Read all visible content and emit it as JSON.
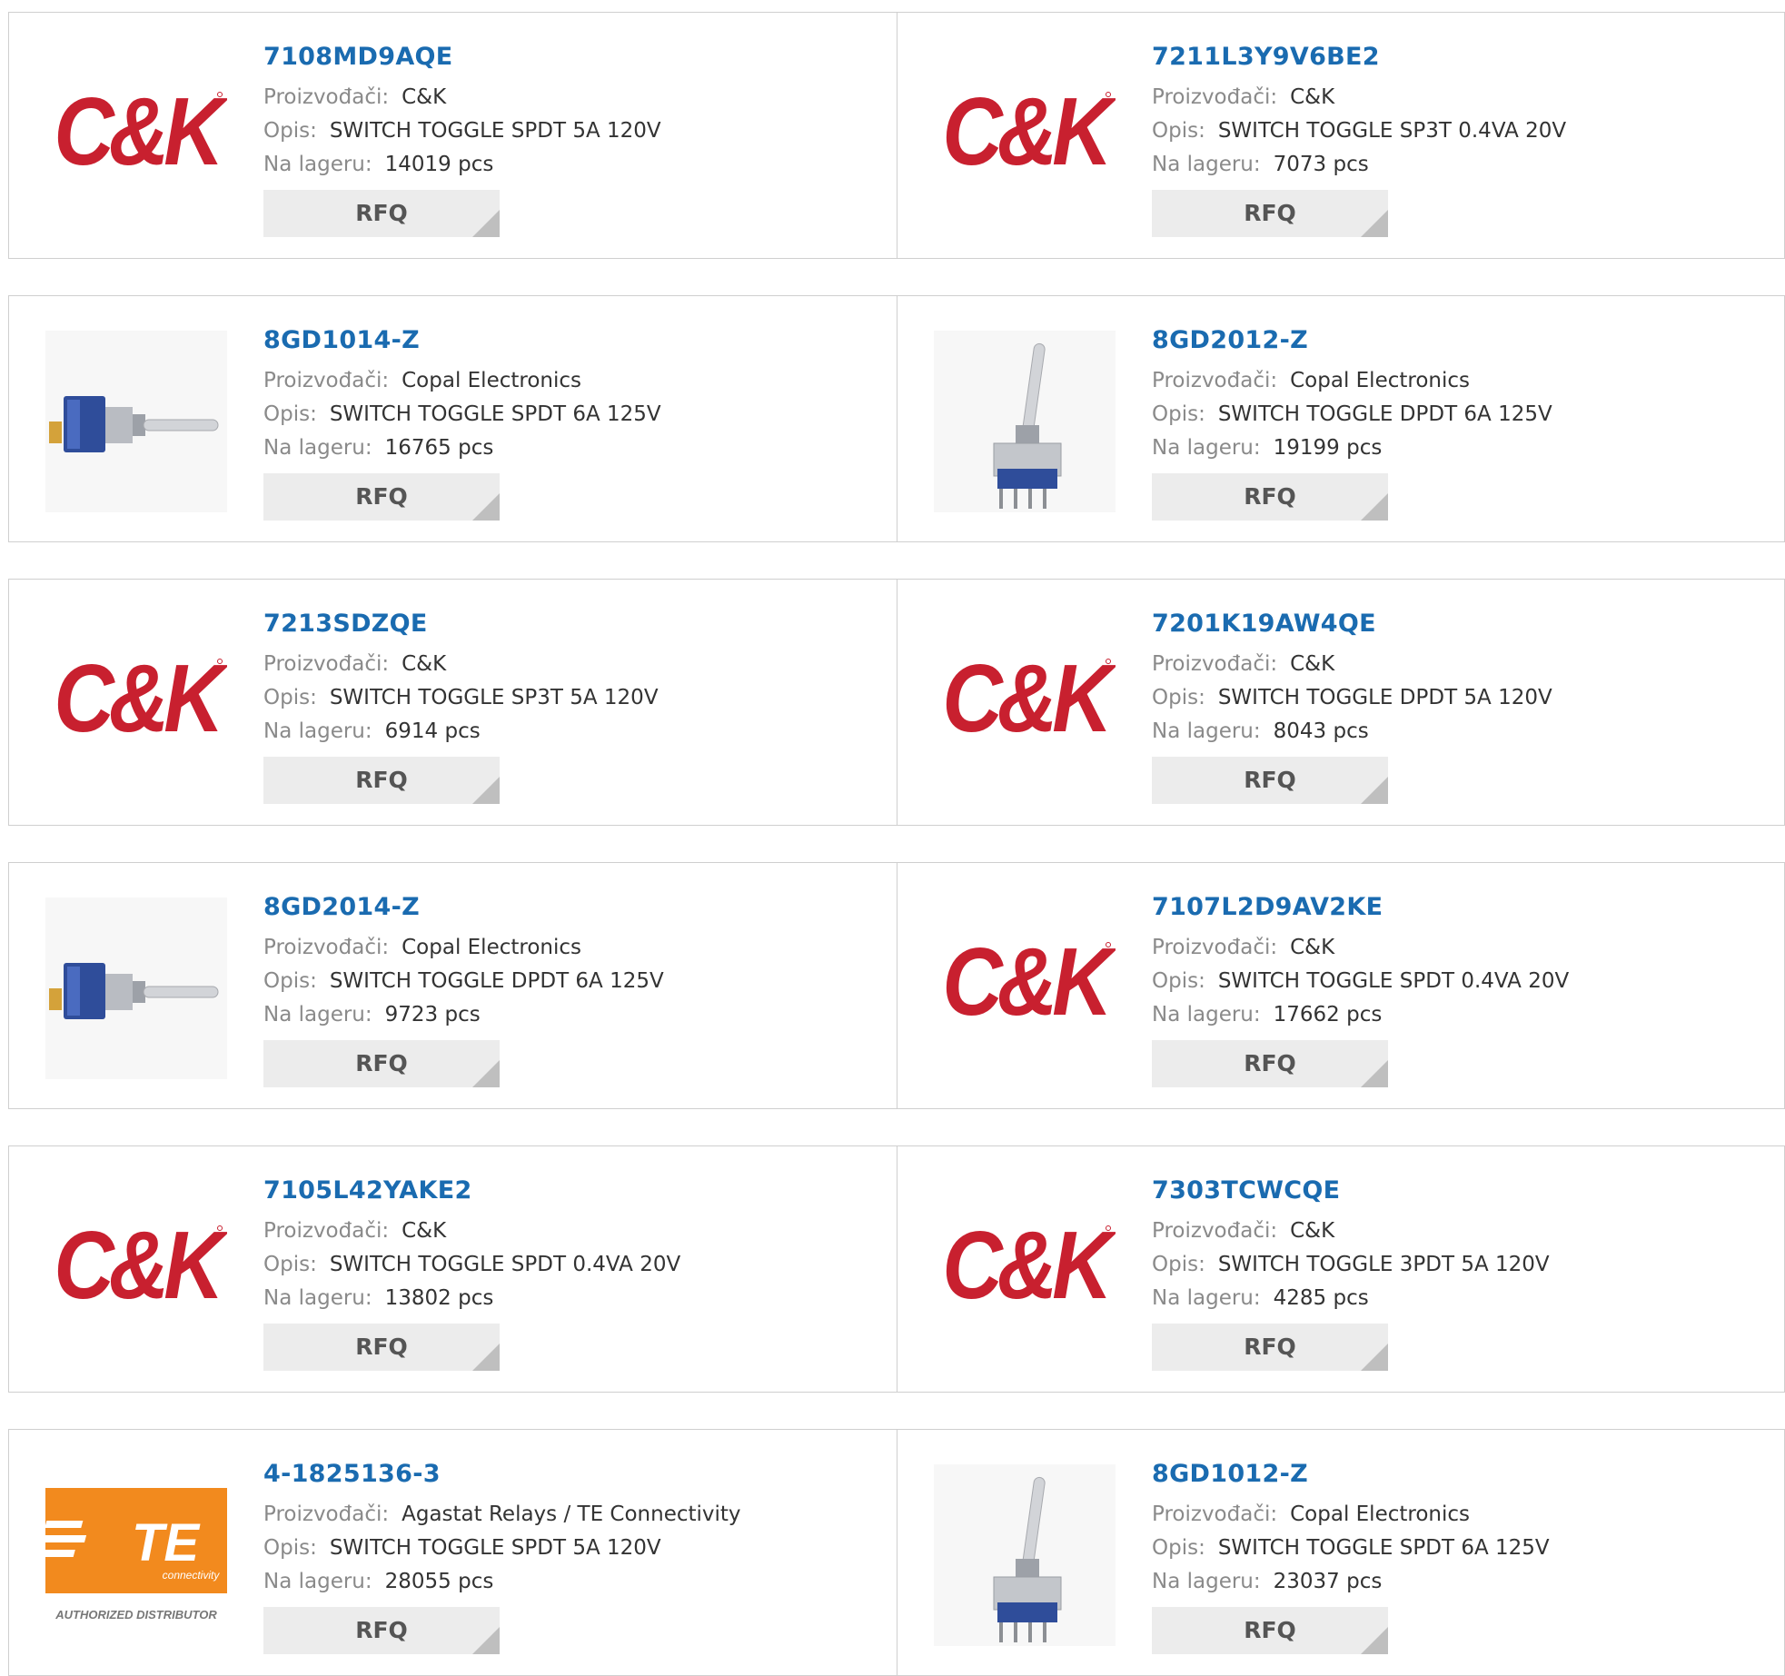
{
  "labels": {
    "manufacturer": "Proizvođači:",
    "description": "Opis:",
    "stock": "Na lageru:",
    "rfq": "RFQ"
  },
  "logos": {
    "ck_text": "C&K",
    "te_text": "TE",
    "te_sub": "connectivity",
    "te_authorized": "AUTHORIZED DISTRIBUTOR"
  },
  "colors": {
    "part_link": "#1a6bb0",
    "ck_red": "#c8202f",
    "te_orange": "#f28a1e",
    "rfq_bg": "#ececec"
  },
  "products": [
    {
      "part": "7108MD9AQE",
      "manufacturer": "C&K",
      "description": "SWITCH TOGGLE SPDT 5A 120V",
      "stock": "14019 pcs",
      "image": "ck-logo"
    },
    {
      "part": "7211L3Y9V6BE2",
      "manufacturer": "C&K",
      "description": "SWITCH TOGGLE SP3T 0.4VA 20V",
      "stock": "7073 pcs",
      "image": "ck-logo"
    },
    {
      "part": "8GD1014-Z",
      "manufacturer": "Copal Electronics",
      "description": "SWITCH TOGGLE SPDT 6A 125V",
      "stock": "16765 pcs",
      "image": "toggle-horizontal-photo"
    },
    {
      "part": "8GD2012-Z",
      "manufacturer": "Copal Electronics",
      "description": "SWITCH TOGGLE DPDT 6A 125V",
      "stock": "19199 pcs",
      "image": "toggle-vertical-photo"
    },
    {
      "part": "7213SDZQE",
      "manufacturer": "C&K",
      "description": "SWITCH TOGGLE SP3T 5A 120V",
      "stock": "6914 pcs",
      "image": "ck-logo"
    },
    {
      "part": "7201K19AW4QE",
      "manufacturer": "C&K",
      "description": "SWITCH TOGGLE DPDT 5A 120V",
      "stock": "8043 pcs",
      "image": "ck-logo"
    },
    {
      "part": "8GD2014-Z",
      "manufacturer": "Copal Electronics",
      "description": "SWITCH TOGGLE DPDT 6A 125V",
      "stock": "9723 pcs",
      "image": "toggle-horizontal-photo"
    },
    {
      "part": "7107L2D9AV2KE",
      "manufacturer": "C&K",
      "description": "SWITCH TOGGLE SPDT 0.4VA 20V",
      "stock": "17662 pcs",
      "image": "ck-logo"
    },
    {
      "part": "7105L42YAKE2",
      "manufacturer": "C&K",
      "description": "SWITCH TOGGLE SPDT 0.4VA 20V",
      "stock": "13802 pcs",
      "image": "ck-logo"
    },
    {
      "part": "7303TCWCQE",
      "manufacturer": "C&K",
      "description": "SWITCH TOGGLE 3PDT 5A 120V",
      "stock": "4285 pcs",
      "image": "ck-logo"
    },
    {
      "part": "4-1825136-3",
      "manufacturer": "Agastat Relays / TE Connectivity",
      "description": "SWITCH TOGGLE SPDT 5A 120V",
      "stock": "28055 pcs",
      "image": "te-logo"
    },
    {
      "part": "8GD1012-Z",
      "manufacturer": "Copal Electronics",
      "description": "SWITCH TOGGLE SPDT 6A 125V",
      "stock": "23037 pcs",
      "image": "toggle-vertical-photo"
    }
  ]
}
